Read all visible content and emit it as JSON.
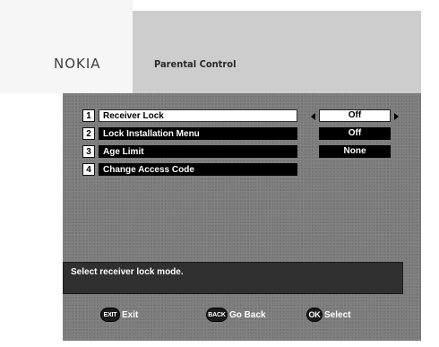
{
  "header": {
    "brand": "NOKIA",
    "title": "Parental Control"
  },
  "menu": {
    "items": [
      {
        "number": "1",
        "label": "Receiver Lock"
      },
      {
        "number": "2",
        "label": "Lock Installation Menu"
      },
      {
        "number": "3",
        "label": "Age Limit"
      },
      {
        "number": "4",
        "label": "Change Access Code"
      }
    ],
    "selected_index": 0
  },
  "values": [
    {
      "value": "Off"
    },
    {
      "value": "Off"
    },
    {
      "value": "None"
    }
  ],
  "help": {
    "text": "Select receiver lock mode."
  },
  "footer": {
    "exit_key": "EXIT",
    "exit_label": "Exit",
    "back_key": "BACK",
    "back_label": "Go Back",
    "ok_key": "OK",
    "ok_label": "Select"
  }
}
